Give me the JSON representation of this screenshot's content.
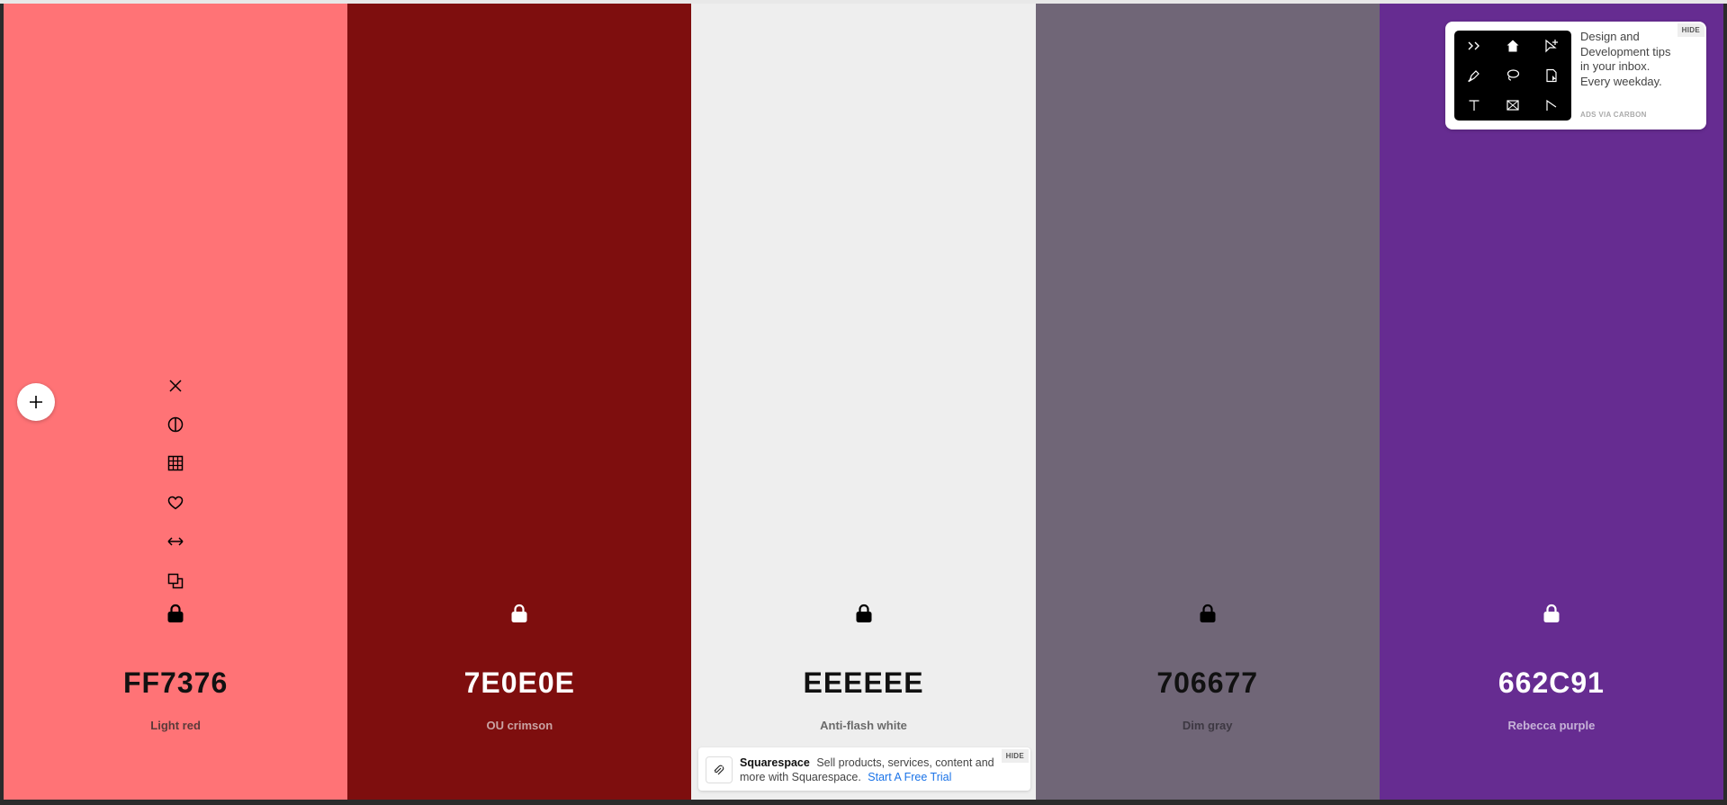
{
  "swatches": [
    {
      "hex": "FF7376",
      "name": "Light red",
      "bg": "#FF7376",
      "fg": "#111111",
      "name_color": "#5a3a3a",
      "lock_color": "#000000"
    },
    {
      "hex": "7E0E0E",
      "name": "OU crimson",
      "bg": "#7E0E0E",
      "fg": "#ffffff",
      "name_color": "#c9a3a3",
      "lock_color": "#ffffff"
    },
    {
      "hex": "EEEEEE",
      "name": "Anti-flash white",
      "bg": "#EEEEEE",
      "fg": "#111111",
      "name_color": "#6a6a6a",
      "lock_color": "#000000"
    },
    {
      "hex": "706677",
      "name": "Dim gray",
      "bg": "#706677",
      "fg": "#111111",
      "name_color": "#3d3842",
      "lock_color": "#000000"
    },
    {
      "hex": "662C91",
      "name": "Rebecca purple",
      "bg": "#662C91",
      "fg": "#ffffff",
      "name_color": "#c7b3d8",
      "lock_color": "#ffffff"
    }
  ],
  "tools": [
    "close-icon",
    "contrast-icon",
    "shades-grid-icon",
    "heart-icon",
    "drag-arrows-icon",
    "copy-icon"
  ],
  "carbon_ad": {
    "text": "Design and Development tips in your inbox. Every weekday.",
    "via": "ADS VIA CARBON",
    "hide": "HIDE"
  },
  "squarespace_ad": {
    "brand": "Squarespace",
    "text": "Sell products, services, content and more with Squarespace.",
    "cta": "Start A Free Trial",
    "hide": "HIDE"
  }
}
